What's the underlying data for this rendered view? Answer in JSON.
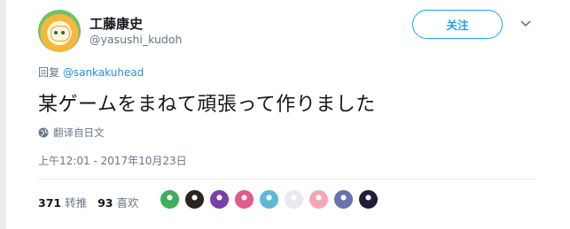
{
  "user": {
    "display_name": "工藤康史",
    "handle": "@yasushi_kudoh",
    "avatar_icon": "user-avatar"
  },
  "follow_button": {
    "label": "关注"
  },
  "menu": {
    "icon": "chevron-down-icon"
  },
  "reply_to": {
    "prefix": "回复",
    "mention": "@sankakuhead"
  },
  "tweet": {
    "text": "某ゲームをまねて頑張って作りました"
  },
  "translate": {
    "icon": "globe-icon",
    "label": "翻译自日文"
  },
  "timestamp": "上午12:01 - 2017年10月23日",
  "stats": {
    "retweets": {
      "count": "371",
      "label": "转推"
    },
    "likes": {
      "count": "93",
      "label": "喜欢"
    }
  },
  "likers": [
    {
      "name": "liker-avatar-1",
      "color": "#3fae5a"
    },
    {
      "name": "liker-avatar-2",
      "color": "#2b2420"
    },
    {
      "name": "liker-avatar-3",
      "color": "#7a3fa8"
    },
    {
      "name": "liker-avatar-4",
      "color": "#e05a8a"
    },
    {
      "name": "liker-avatar-5",
      "color": "#5fb8d8"
    },
    {
      "name": "liker-avatar-6",
      "color": "#e8e8ee"
    },
    {
      "name": "liker-avatar-7",
      "color": "#f4a6b8"
    },
    {
      "name": "liker-avatar-8",
      "color": "#6a70b0"
    },
    {
      "name": "liker-avatar-9",
      "color": "#1e1e3a"
    }
  ],
  "colors": {
    "accent": "#1da1f2",
    "link": "#1b95e0",
    "muted": "#657786",
    "text": "#14171a"
  }
}
